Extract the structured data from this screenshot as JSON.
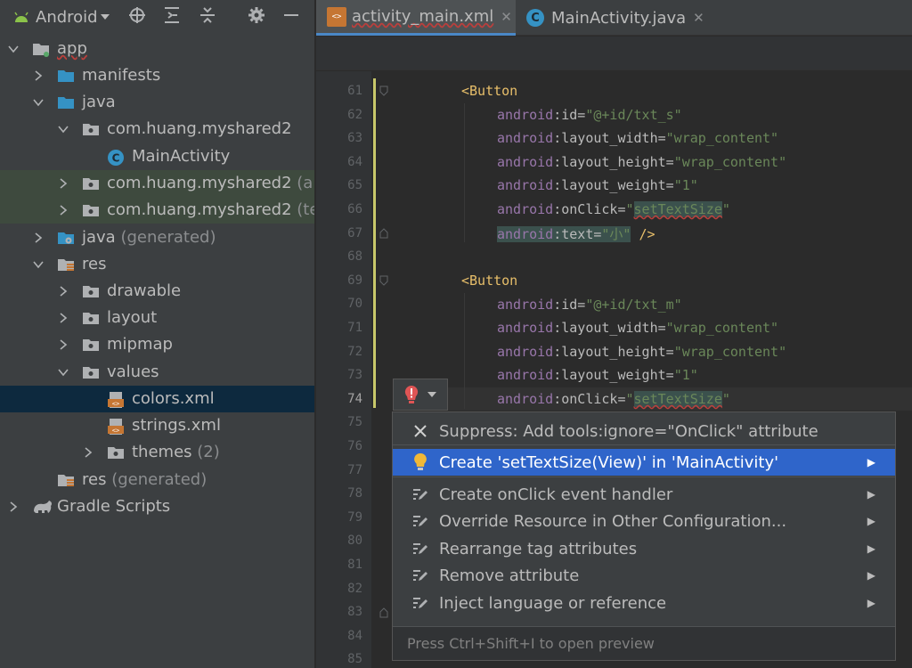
{
  "project_view": {
    "selector_label": "Android",
    "toolbar_icons": [
      "locate-icon",
      "expand-all-icon",
      "collapse-all-icon",
      "settings-icon",
      "hide-icon"
    ],
    "tree": [
      {
        "label": "app",
        "suffix": "",
        "icon": "module-folder-icon",
        "arrow": "down"
      },
      {
        "label": "manifests",
        "suffix": "",
        "icon": "folder-icon",
        "arrow": "right"
      },
      {
        "label": "java",
        "suffix": "",
        "icon": "folder-icon",
        "arrow": "down"
      },
      {
        "label": "com.huang.myshared2",
        "suffix": "",
        "icon": "package-icon",
        "arrow": "down"
      },
      {
        "label": "MainActivity",
        "suffix": "",
        "icon": "class-icon",
        "arrow": ""
      },
      {
        "label": "com.huang.myshared2",
        "suffix": "(ar",
        "icon": "package-icon",
        "arrow": "right"
      },
      {
        "label": "com.huang.myshared2",
        "suffix": "(te",
        "icon": "package-icon",
        "arrow": "right"
      },
      {
        "label": "java",
        "suffix": "(generated)",
        "icon": "generated-folder-icon",
        "arrow": "right"
      },
      {
        "label": "res",
        "suffix": "",
        "icon": "res-folder-icon",
        "arrow": "down"
      },
      {
        "label": "drawable",
        "suffix": "",
        "icon": "package-icon",
        "arrow": "right"
      },
      {
        "label": "layout",
        "suffix": "",
        "icon": "package-icon",
        "arrow": "right"
      },
      {
        "label": "mipmap",
        "suffix": "",
        "icon": "package-icon",
        "arrow": "right"
      },
      {
        "label": "values",
        "suffix": "",
        "icon": "package-icon",
        "arrow": "down"
      },
      {
        "label": "colors.xml",
        "suffix": "",
        "icon": "xml-file-icon",
        "arrow": ""
      },
      {
        "label": "strings.xml",
        "suffix": "",
        "icon": "xml-file-icon",
        "arrow": ""
      },
      {
        "label": "themes",
        "suffix": "(2)",
        "icon": "package-icon",
        "arrow": "right"
      },
      {
        "label": "res",
        "suffix": "(generated)",
        "icon": "res-folder-icon",
        "arrow": ""
      },
      {
        "label": "Gradle Scripts",
        "suffix": "",
        "icon": "gradle-icon",
        "arrow": "right"
      }
    ]
  },
  "editor": {
    "tabs": [
      {
        "label": "activity_main.xml",
        "icon": "xml-file-icon",
        "close": "✕",
        "active": true
      },
      {
        "label": "MainActivity.java",
        "icon": "class-icon",
        "close": "✕",
        "active": false
      }
    ],
    "line_numbers": [
      "61",
      "62",
      "63",
      "64",
      "65",
      "66",
      "67",
      "68",
      "69",
      "70",
      "71",
      "72",
      "73",
      "74",
      "75",
      "76",
      "77",
      "78",
      "79",
      "80",
      "81",
      "82",
      "83",
      "84",
      "85"
    ],
    "current_line": "74",
    "code": {
      "btn1_open": "<",
      "btn1_tag": "Button",
      "btn1_id": [
        "android",
        ":id=",
        "\"@+id/txt_s\""
      ],
      "btn1_w": [
        "android",
        ":layout_width=",
        "\"wrap_content\""
      ],
      "btn1_h": [
        "android",
        ":layout_height=",
        "\"wrap_content\""
      ],
      "btn1_wt": [
        "android",
        ":layout_weight=",
        "\"1\""
      ],
      "btn1_click": [
        "android",
        ":onClick=",
        "\"",
        "setTextSize",
        "\""
      ],
      "btn1_text": [
        "android",
        ":text=",
        "\"小\"",
        " />"
      ],
      "btn2_open": "<",
      "btn2_tag": "Button",
      "btn2_id": [
        "android",
        ":id=",
        "\"@+id/txt_m\""
      ],
      "btn2_w": [
        "android",
        ":layout_width=",
        "\"wrap_content\""
      ],
      "btn2_h": [
        "android",
        ":layout_height=",
        "\"wrap_content\""
      ],
      "btn2_wt": [
        "android",
        ":layout_weight=",
        "\"1\""
      ],
      "btn2_click": [
        "android",
        ":onClick=",
        "\"",
        "setTextSize",
        "\""
      ]
    }
  },
  "intention_popup": {
    "items": [
      {
        "label": "Suppress: Add tools:ignore=\"OnClick\" attribute",
        "icon": "close-icon",
        "submenu": false,
        "selected": false
      },
      {
        "label": "Create 'setTextSize(View)' in 'MainActivity'",
        "icon": "lightbulb-icon",
        "submenu": true,
        "selected": true
      },
      {
        "label": "Create onClick event handler",
        "icon": "pencil-icon",
        "submenu": true,
        "selected": false
      },
      {
        "label": "Override Resource in Other Configuration...",
        "icon": "pencil-icon",
        "submenu": true,
        "selected": false
      },
      {
        "label": "Rearrange tag attributes",
        "icon": "pencil-icon",
        "submenu": true,
        "selected": false
      },
      {
        "label": "Remove attribute",
        "icon": "pencil-icon",
        "submenu": true,
        "selected": false
      },
      {
        "label": "Inject language or reference",
        "icon": "pencil-icon",
        "submenu": true,
        "selected": false
      }
    ],
    "submenu_arrow": "▶",
    "footer": "Press Ctrl+Shift+I to open preview"
  },
  "colors": {
    "selection_blue": "#2f65ca",
    "tree_selected": "#0d293e",
    "xml_tag": "#e8bf6a",
    "xml_namespace": "#9876aa",
    "xml_value": "#6a8759",
    "error_red": "#bc3f3c"
  }
}
